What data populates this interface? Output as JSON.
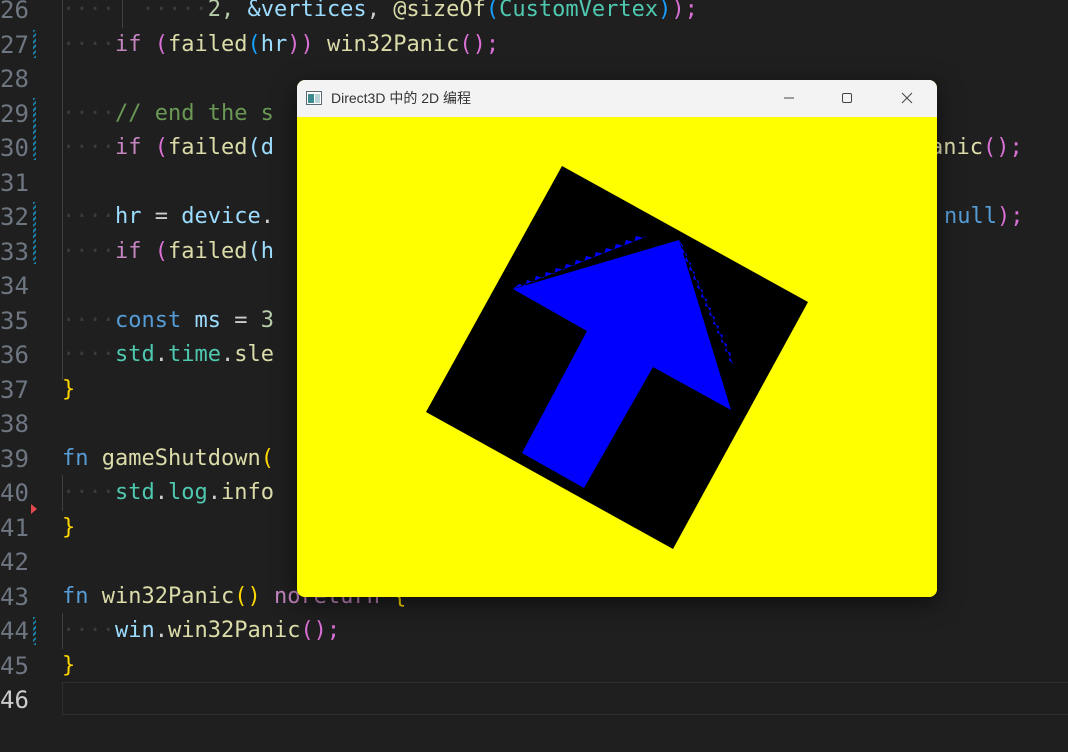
{
  "editor": {
    "lines": [
      {
        "num": "26"
      },
      {
        "num": "27"
      },
      {
        "num": "28"
      },
      {
        "num": "29"
      },
      {
        "num": "30"
      },
      {
        "num": "31"
      },
      {
        "num": "32"
      },
      {
        "num": "33"
      },
      {
        "num": "34"
      },
      {
        "num": "35"
      },
      {
        "num": "36"
      },
      {
        "num": "37"
      },
      {
        "num": "38"
      },
      {
        "num": "39"
      },
      {
        "num": "40"
      },
      {
        "num": "41"
      },
      {
        "num": "42"
      },
      {
        "num": "43"
      },
      {
        "num": "44"
      },
      {
        "num": "45"
      },
      {
        "num": "46"
      }
    ],
    "code": {
      "l26": {
        "a": "2, ",
        "b": "&vertices",
        "c": ", ",
        "d": "@sizeOf",
        "e": "(",
        "f": "CustomVertex",
        "g": ")",
        "h": ");"
      },
      "l27": {
        "a": "if",
        "b": " (",
        "c": "failed",
        "d": "(",
        "e": "hr",
        "f": ")) ",
        "g": "win32Panic",
        "h": "();"
      },
      "l29": {
        "a": "// end the s"
      },
      "l30": {
        "a": "if",
        "b": " (",
        "c": "failed",
        "d": "(d",
        "e": "anic",
        "f": "();"
      },
      "l32": {
        "a": "hr",
        "b": " = ",
        "c": "device",
        "d": ".",
        "e": "null",
        "f": ");"
      },
      "l33": {
        "a": "if",
        "b": " (",
        "c": "failed",
        "d": "(h"
      },
      "l35": {
        "a": "const",
        "b": " ms",
        "c": " = ",
        "d": "3"
      },
      "l36": {
        "a": "std",
        "b": ".",
        "c": "time",
        "d": ".",
        "e": "sle"
      },
      "l37": {
        "a": "}"
      },
      "l39": {
        "a": "fn",
        "b": " ",
        "c": "gameShutdown",
        "d": "("
      },
      "l40": {
        "a": "std",
        "b": ".",
        "c": "log",
        "d": ".",
        "e": "info"
      },
      "l41": {
        "a": "}"
      },
      "l43": {
        "a": "fn",
        "b": " ",
        "c": "win32Panic",
        "d": "()",
        "e": " noreturn ",
        "f": "{"
      },
      "l44": {
        "a": "win",
        "b": ".",
        "c": "win32Panic",
        "d": "();"
      },
      "l45": {
        "a": "}"
      }
    }
  },
  "window": {
    "title": "Direct3D 中的 2D 编程",
    "buttons": {
      "minimize": "minimize-icon",
      "maximize": "maximize-icon",
      "close": "close-icon"
    },
    "colors": {
      "background": "#ffff00",
      "square": "#000000",
      "arrow": "#0000ff"
    }
  }
}
